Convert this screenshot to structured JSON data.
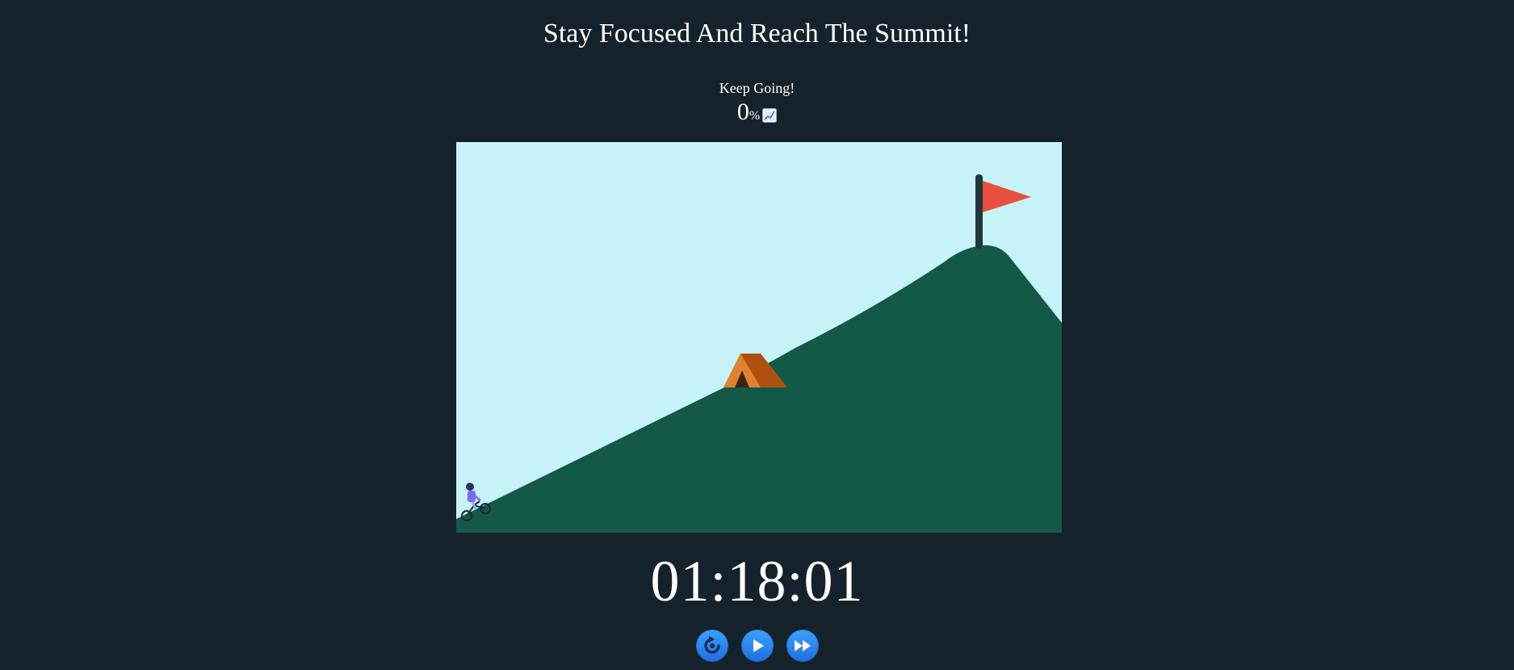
{
  "header": {
    "title": "Stay Focused And Reach The Summit!"
  },
  "status": {
    "message": "Keep Going!",
    "progress_value": "0",
    "progress_unit": "%",
    "progress_icon": "chart-increasing-icon",
    "progress_fraction": 0
  },
  "scene": {
    "sky_color": "#c5f3f8",
    "mountain_color": "#135947",
    "flag_color": "#e8513f",
    "pole_color": "#23363c",
    "tent_colors": [
      "#e0822d",
      "#b0500f",
      "#3b2614"
    ],
    "rider_icon": "cyclist-icon",
    "tent_icon": "tent-icon",
    "flag_icon": "summit-flag-icon"
  },
  "timer": {
    "display": "01:18:01"
  },
  "controls": {
    "restart_icon": "restart-icon",
    "play_icon": "play-icon",
    "fast_forward_icon": "fast-forward-icon",
    "button_color": "#2a86f0"
  }
}
